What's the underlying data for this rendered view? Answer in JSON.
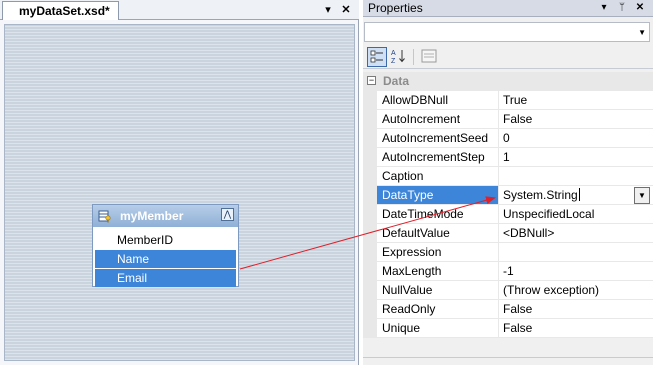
{
  "document": {
    "tab_label": "myDataSet.xsd*",
    "pin_glyph": "▾",
    "close_glyph": "✕",
    "table": {
      "name": "myMember",
      "icon": "table-key-icon",
      "collapse_glyph": "⋀",
      "columns": [
        {
          "label": "MemberID",
          "selected": false
        },
        {
          "label": "Name",
          "selected": true
        },
        {
          "label": "Email",
          "selected": true
        }
      ]
    }
  },
  "properties": {
    "title": "Properties",
    "ctrl_dropdown": "▾",
    "ctrl_pin": "ᛘ",
    "ctrl_close": "✕",
    "object_selector_value": "",
    "toolbar": {
      "categorized_icon": "categorized-icon",
      "alphabetical_icon": "alphabetical-icon",
      "property_pages_icon": "property-pages-icon"
    },
    "category": {
      "label": "Data",
      "toggle": "−"
    },
    "rows": [
      {
        "name": "AllowDBNull",
        "value": "True"
      },
      {
        "name": "AutoIncrement",
        "value": "False"
      },
      {
        "name": "AutoIncrementSeed",
        "value": "0"
      },
      {
        "name": "AutoIncrementStep",
        "value": "1"
      },
      {
        "name": "Caption",
        "value": ""
      },
      {
        "name": "DataType",
        "value": "System.String"
      },
      {
        "name": "DateTimeMode",
        "value": "UnspecifiedLocal"
      },
      {
        "name": "DefaultValue",
        "value": "<DBNull>"
      },
      {
        "name": "Expression",
        "value": ""
      },
      {
        "name": "MaxLength",
        "value": "-1"
      },
      {
        "name": "NullValue",
        "value": "(Throw exception)"
      },
      {
        "name": "ReadOnly",
        "value": "False"
      },
      {
        "name": "Unique",
        "value": "False"
      }
    ],
    "selected_row": "DataType"
  },
  "colors": {
    "selection": "#3d85d9",
    "arrow": "#e0202a",
    "category_text": "#8c8c8c"
  }
}
